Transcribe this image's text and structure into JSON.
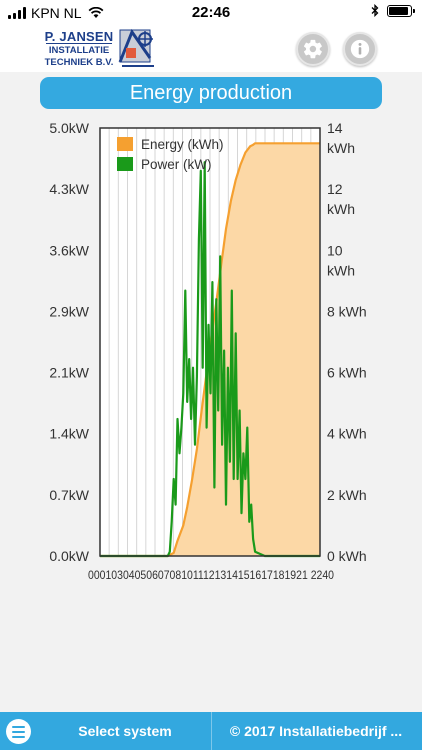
{
  "status_bar": {
    "carrier": "KPN NL",
    "time": "22:46",
    "battery_level": 0.9
  },
  "header": {
    "logo": {
      "name": "P. JANSEN",
      "line1": "INSTALLATIE",
      "line2": "TECHNIEK B.V."
    },
    "settings_icon": "gear-icon",
    "info_icon": "info-icon"
  },
  "title": "Energy production",
  "chart_data": {
    "type": "line",
    "legend": [
      "Energy (kWh)",
      "Power (kW)"
    ],
    "legend_position": "top-left",
    "grid": true,
    "y_left": {
      "ticks": [
        "0.0kW",
        "0.7kW",
        "1.4kW",
        "2.1kW",
        "2.9kW",
        "3.6kW",
        "4.3kW",
        "5.0kW"
      ],
      "min": 0,
      "max": 5.0
    },
    "y_right": {
      "ticks": [
        "0 kWh",
        "2 kWh",
        "4 kWh",
        "6 kWh",
        "8 kWh",
        "10 kWh",
        "12 kWh",
        "14 kWh"
      ],
      "min": 0,
      "max": 14
    },
    "x_ticks_text": "00010304050607081011121314151617181921 2240",
    "series": [
      {
        "name": "Energy (kWh)",
        "type": "area",
        "color": "#f5a030",
        "fill": "#fcd8a6",
        "x": [
          0,
          7.0,
          7.6,
          8.0,
          8.6,
          9.0,
          9.5,
          10.0,
          10.5,
          11.0,
          11.5,
          12.0,
          12.5,
          13.0,
          13.5,
          14.0,
          14.5,
          15.0,
          15.5,
          15.8,
          16.0,
          17.0,
          18.0,
          19.0,
          20.0,
          21.0,
          22.7
        ],
        "values": [
          0,
          0,
          0.1,
          0.5,
          1.0,
          1.6,
          2.5,
          3.5,
          4.8,
          6.0,
          7.2,
          8.3,
          9.5,
          10.7,
          11.6,
          12.3,
          12.8,
          13.2,
          13.4,
          13.45,
          13.5,
          13.5,
          13.5,
          13.5,
          13.5,
          13.5,
          13.5
        ]
      },
      {
        "name": "Power (kW)",
        "type": "line",
        "color": "#1a9a1a",
        "x": [
          0,
          7.0,
          7.2,
          7.4,
          7.6,
          7.8,
          8.0,
          8.2,
          8.4,
          8.6,
          8.8,
          9.0,
          9.2,
          9.4,
          9.6,
          9.8,
          10.0,
          10.2,
          10.4,
          10.6,
          10.8,
          11.0,
          11.2,
          11.4,
          11.6,
          11.8,
          12.0,
          12.2,
          12.4,
          12.6,
          12.8,
          13.0,
          13.2,
          13.4,
          13.6,
          13.8,
          14.0,
          14.2,
          14.4,
          14.6,
          14.8,
          15.0,
          15.2,
          15.4,
          15.6,
          15.8,
          16.0,
          17.0,
          18.0,
          19.0,
          20.0,
          21.0,
          22.7
        ],
        "values": [
          0,
          0,
          0.05,
          0.4,
          0.9,
          0.6,
          1.6,
          1.2,
          1.5,
          1.9,
          3.1,
          1.8,
          2.3,
          1.6,
          2.2,
          1.3,
          2.1,
          3.7,
          4.5,
          2.2,
          4.6,
          1.5,
          2.7,
          1.9,
          3.2,
          0.8,
          3.0,
          1.7,
          3.5,
          1.3,
          2.4,
          0.6,
          2.2,
          1.1,
          3.1,
          0.9,
          2.6,
          0.9,
          1.7,
          0.5,
          1.2,
          0.9,
          1.5,
          0.4,
          0.6,
          0.2,
          0.05,
          0,
          0,
          0,
          0,
          0,
          0
        ]
      }
    ]
  },
  "footer": {
    "menu_icon": "menu-icon",
    "select_system": "Select system",
    "copyright": "© 2017 Installatiebedrijf ..."
  }
}
